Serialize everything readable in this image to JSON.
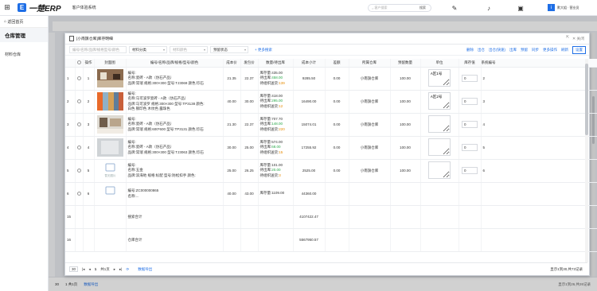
{
  "topbar": {
    "logo_text": "一楚ERP",
    "system_name": "客户体验系统",
    "search_placeholder": "客户搜索",
    "search_button": "搜索",
    "user_name": "默大姐 · 营业员"
  },
  "sidebar": {
    "back_label": "返回首页",
    "title": "仓库管理",
    "item": "材料仓库"
  },
  "background": {
    "bottom_pagesize": "30",
    "bottom_page_info": "1  共1页",
    "bottom_export": "数据导出",
    "bottom_right": "显示1到26,共26记录"
  },
  "modal": {
    "title": "[小南旗仓库]库存明细",
    "header_tools": [
      "⇱",
      "✕ 关闭"
    ],
    "filter_placeholder": "编号/名称/品牌/规格型号/颜色",
    "filter_material_class": "材料分类",
    "filter_material_attr": "材料颜色",
    "filter_stock_status": "预留状态",
    "more_search": "+ 更多搜索",
    "actions": [
      "删除",
      "出仓",
      "出仓(快速)",
      "出库",
      "预留",
      "同步",
      "更多操作",
      "刷新"
    ],
    "settings_label": "设置",
    "columns": [
      "",
      "操作",
      "封面图",
      "编号/名称/品牌/规格/型号/颜色",
      "成本价",
      "发包价",
      "数量/待出库",
      "成本小计",
      "差额",
      "所属仓库",
      "预留数量",
      "单位",
      "库存值",
      "系统编号"
    ],
    "rows": [
      {
        "no": "1",
        "desc": [
          "编号:",
          "名称:瓷砖 - A款（仿石产品）",
          "品牌:常瑞  规格:300×300  型号:TJ3069  颜色:珍石"
        ],
        "cost": "21.35",
        "pack": "22.37",
        "stock": [
          "库存量:435.00",
          "待出库:",
          "458.00",
          "待组织送货:",
          "139"
        ],
        "subtotal": "9285.50",
        "diff": "0.00",
        "warehouse": "小南旗仓库",
        "reserve": "100.00",
        "unit": "A区1号",
        "qty": "0",
        "sysno": "2"
      },
      {
        "no": "2",
        "desc": [
          "编号:",
          "名称:马可波罗瓷砖 - A款（仿石产品）",
          "品牌:马可波罗  规格:300×300  型号:TP3138  颜色:",
          "白色 钢印色 木纹色 露珠色"
        ],
        "cost": "40.00",
        "pack": "30.00",
        "stock": [
          "库存量:418.00",
          "待出库:",
          "295.00",
          "待组织送货:",
          "12"
        ],
        "subtotal": "16490.00",
        "diff": "0.00",
        "warehouse": "小南旗仓库",
        "reserve": "100.00",
        "unit": "A区2号",
        "qty": "0",
        "sysno": "3"
      },
      {
        "no": "3",
        "desc": [
          "编号:",
          "名称:瓷砖 - A款（仿石产品）",
          "品牌:常瑞  规格:600*600  型号:TP3131  颜色:珍石"
        ],
        "cost": "21.30",
        "pack": "22.37",
        "stock": [
          "库存量:707.70",
          "待出库:",
          "148.00",
          "待组织送货:",
          "220"
        ],
        "subtotal": "15074.01",
        "diff": "0.00",
        "warehouse": "小南旗仓库",
        "reserve": "100.00",
        "unit": "",
        "qty": "0",
        "sysno": "4"
      },
      {
        "no": "4",
        "desc": [
          "编号:",
          "名称:瓷砖 - A款（仿石产品）",
          "品牌:常瑞  规格:300×300  型号:TJ3063  颜色:珍石"
        ],
        "cost": "30.00",
        "pack": "25.00",
        "stock": [
          "库存量:574.00",
          "待出库:",
          "68.00",
          "待组织送货:",
          "15"
        ],
        "subtotal": "17255.92",
        "diff": "0.00",
        "warehouse": "小南旗仓库",
        "reserve": "100.00",
        "unit": "",
        "qty": "0",
        "sysno": "5"
      },
      {
        "no": "5",
        "desc": [
          "编号:",
          "名称:五金",
          "品牌:滨海地  规格:标配  型号:防松扣手  颜色:"
        ],
        "cost": "25.00",
        "pack": "26.25",
        "stock": [
          "库存量:101.00",
          "待出库:",
          "20.00",
          "待组织送货:",
          "3"
        ],
        "subtotal": "2525.00",
        "diff": "0.00",
        "warehouse": "小南旗仓库",
        "reserve": "100.00",
        "unit": "",
        "qty": "0",
        "sysno": "6"
      },
      {
        "no": "6",
        "desc": [
          "编号:ZC000000865",
          "名称:..."
        ],
        "cost": "40.00",
        "pack": "43.00",
        "stock": [
          "库存量:1109.00",
          "",
          "",
          "",
          ""
        ],
        "subtotal": "44360.00",
        "diff": "",
        "warehouse": "",
        "reserve": "",
        "unit": "",
        "qty": "",
        "sysno": ""
      }
    ],
    "summary": [
      {
        "label": "搜索合计",
        "value": "4107422.47"
      },
      {
        "label": "仓库合计",
        "value": "5567950.57"
      }
    ],
    "row_numbers": [
      "1",
      "2",
      "3",
      "4",
      "5",
      "6",
      "7",
      "8",
      "9",
      "10",
      "11",
      "12",
      "13",
      "14",
      "15",
      "16"
    ],
    "pager": {
      "page_size": "30",
      "page": "1",
      "total_pages": "共1页",
      "export": "数据导出",
      "info": "显示1到30,共73记录"
    }
  }
}
